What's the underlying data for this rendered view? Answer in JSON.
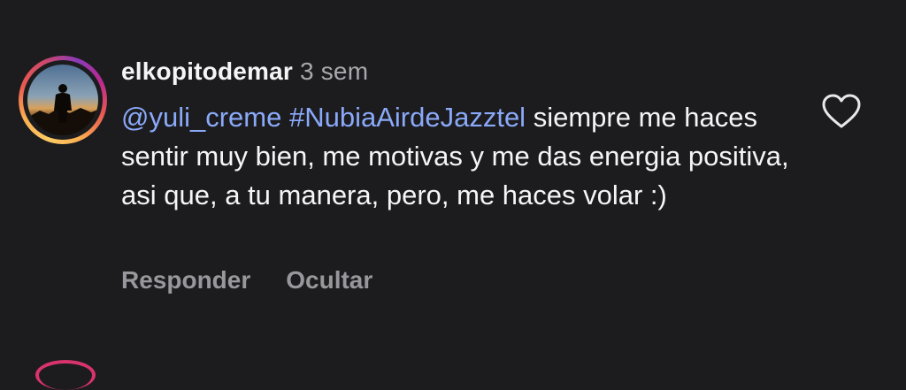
{
  "comment": {
    "username": "elkopitodemar",
    "time_ago": "3 sem",
    "mention": "@yuli_creme",
    "hashtag": "#NubiaAirdeJazztel",
    "text": "siempre me haces sentir muy bien, me motivas y me das energia positiva, asi que, a tu manera, pero, me haces volar :)",
    "like_icon": "heart-outline-icon",
    "actions": {
      "reply_label": "Responder",
      "hide_label": "Ocultar"
    }
  },
  "colors": {
    "background": "#1c1c1f",
    "text": "#f5f5f5",
    "link": "#8aa9f9",
    "muted": "#a8a8ad"
  }
}
